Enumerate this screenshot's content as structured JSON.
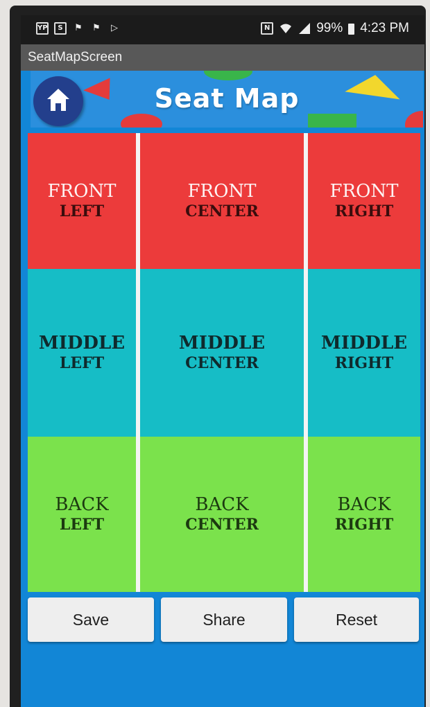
{
  "status_bar": {
    "battery": "99%",
    "time": "4:23 PM",
    "left_icons": [
      "yp-icon",
      "s-icon",
      "flag-icon",
      "flag-icon",
      "play-store-icon"
    ],
    "right_icons": [
      "nfc-icon",
      "wifi-icon",
      "signal-icon",
      "battery-icon"
    ]
  },
  "app": {
    "title": "SeatMapScreen"
  },
  "header": {
    "title": "Seat Map",
    "home_icon": "home-icon"
  },
  "seat_map": {
    "rows": [
      {
        "row": "front",
        "color": "#ec3b3b",
        "seats": [
          {
            "line1": "FRONT",
            "line2": "LEFT"
          },
          {
            "line1": "FRONT",
            "line2": "CENTER"
          },
          {
            "line1": "FRONT",
            "line2": "RIGHT"
          }
        ]
      },
      {
        "row": "middle",
        "color": "#16bdc6",
        "seats": [
          {
            "line1": "MIDDLE",
            "line2": "LEFT"
          },
          {
            "line1": "MIDDLE",
            "line2": "CENTER"
          },
          {
            "line1": "MIDDLE",
            "line2": "RIGHT"
          }
        ]
      },
      {
        "row": "back",
        "color": "#7be24c",
        "seats": [
          {
            "line1": "BACK",
            "line2": "LEFT"
          },
          {
            "line1": "BACK",
            "line2": "CENTER"
          },
          {
            "line1": "BACK",
            "line2": "RIGHT"
          }
        ]
      }
    ]
  },
  "actions": {
    "save": "Save",
    "share": "Share",
    "reset": "Reset"
  },
  "colors": {
    "background": "#1286d6",
    "header_bg": "#2b8fdd",
    "home_button": "#233f8c",
    "titlebar": "#585858"
  }
}
